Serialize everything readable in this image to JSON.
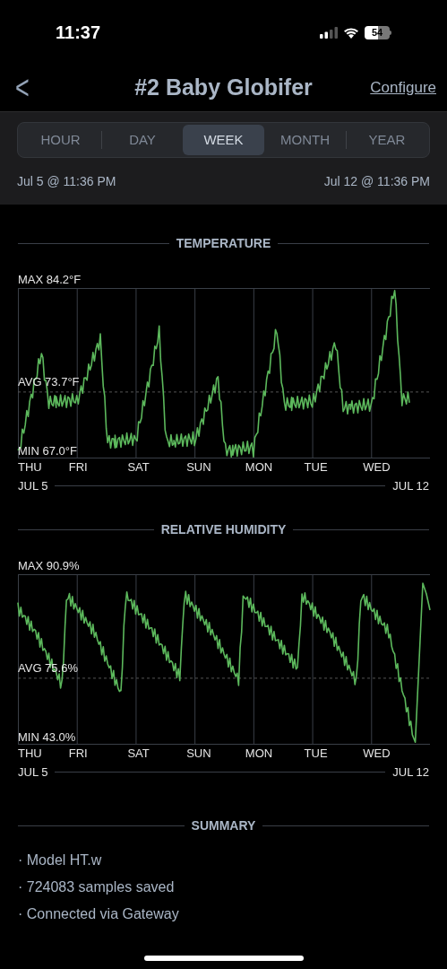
{
  "status_bar": {
    "time": "11:37",
    "battery": "54"
  },
  "nav": {
    "back": "<",
    "title": "#2 Baby Globifer",
    "action": "Configure"
  },
  "tabs": [
    {
      "label": "HOUR",
      "selected": false
    },
    {
      "label": "DAY",
      "selected": false
    },
    {
      "label": "WEEK",
      "selected": true
    },
    {
      "label": "MONTH",
      "selected": false
    },
    {
      "label": "YEAR",
      "selected": false
    }
  ],
  "range": {
    "start": "Jul 5 @ 11:36 PM",
    "end": "Jul 12 @ 11:36 PM"
  },
  "charts": [
    {
      "kind": "temperature",
      "title": "TEMPERATURE",
      "max": "MAX 84.2°F",
      "avg": "AVG 73.7°F",
      "min": "MIN 67.0°F",
      "days": [
        "THU",
        "FRI",
        "SAT",
        "SUN",
        "MON",
        "TUE",
        "WED"
      ],
      "start": "JUL 5",
      "end": "JUL 12"
    },
    {
      "kind": "humidity",
      "title": "RELATIVE HUMIDITY",
      "max": "MAX 90.9%",
      "avg": "AVG 75.6%",
      "min": "MIN 43.0%",
      "days": [
        "THU",
        "FRI",
        "SAT",
        "SUN",
        "MON",
        "TUE",
        "WED"
      ],
      "start": "JUL 5",
      "end": "JUL 12"
    }
  ],
  "summary": {
    "title": "SUMMARY",
    "items": [
      "· Model HT.w",
      "· 724083 samples saved",
      "· Connected via Gateway"
    ]
  }
}
